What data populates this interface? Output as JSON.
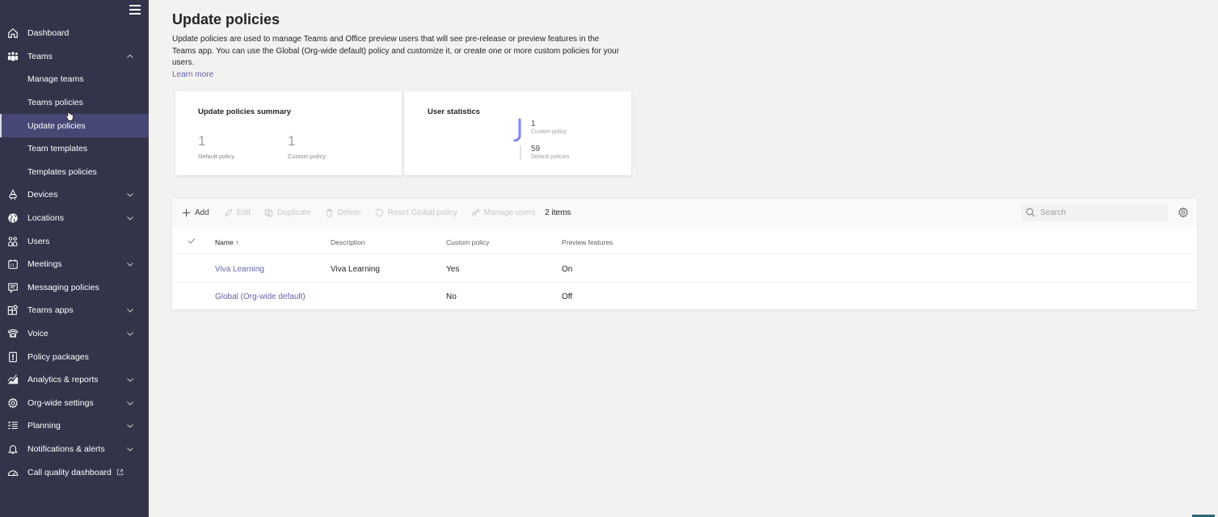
{
  "sidebar": {
    "menu_icon": "hamburger-icon",
    "items": [
      {
        "label": "Dashboard",
        "icon": "home-icon",
        "level": 0,
        "chevron": null
      },
      {
        "label": "Teams",
        "icon": "teams-icon",
        "level": 0,
        "chevron": "up"
      },
      {
        "label": "Manage teams",
        "icon": null,
        "level": 1,
        "chevron": null
      },
      {
        "label": "Teams policies",
        "icon": null,
        "level": 1,
        "chevron": null
      },
      {
        "label": "Update policies",
        "icon": null,
        "level": 1,
        "chevron": null,
        "active": true
      },
      {
        "label": "Team templates",
        "icon": null,
        "level": 1,
        "chevron": null
      },
      {
        "label": "Templates policies",
        "icon": null,
        "level": 1,
        "chevron": null
      },
      {
        "label": "Devices",
        "icon": "devices-icon",
        "level": 0,
        "chevron": "down"
      },
      {
        "label": "Locations",
        "icon": "globe-icon",
        "level": 0,
        "chevron": "down"
      },
      {
        "label": "Users",
        "icon": "users-icon",
        "level": 0,
        "chevron": null
      },
      {
        "label": "Meetings",
        "icon": "calendar-icon",
        "level": 0,
        "chevron": "down"
      },
      {
        "label": "Messaging policies",
        "icon": "message-icon",
        "level": 0,
        "chevron": null
      },
      {
        "label": "Teams apps",
        "icon": "apps-icon",
        "level": 0,
        "chevron": "down"
      },
      {
        "label": "Voice",
        "icon": "phone-icon",
        "level": 0,
        "chevron": "down"
      },
      {
        "label": "Policy packages",
        "icon": "package-icon",
        "level": 0,
        "chevron": null
      },
      {
        "label": "Analytics & reports",
        "icon": "analytics-icon",
        "level": 0,
        "chevron": "down"
      },
      {
        "label": "Org-wide settings",
        "icon": "gear-icon",
        "level": 0,
        "chevron": "down"
      },
      {
        "label": "Planning",
        "icon": "checklist-icon",
        "level": 0,
        "chevron": "down"
      },
      {
        "label": "Notifications & alerts",
        "icon": "bell-icon",
        "level": 0,
        "chevron": "down"
      },
      {
        "label": "Call quality dashboard",
        "icon": "gauge-icon",
        "level": 0,
        "chevron": null,
        "external": true
      }
    ]
  },
  "header": {
    "title": "Update policies",
    "description": "Update policies are used to manage Teams and Office preview users that will see pre-release or preview features in the Teams app. You can use the Global (Org-wide default) policy and customize it, or create one or more custom policies for your users.",
    "learn_more": "Learn more"
  },
  "summary_card": {
    "title": "Update policies summary",
    "stats": [
      {
        "value": "1",
        "label": "Default policy"
      },
      {
        "value": "1",
        "label": "Custom policy"
      }
    ]
  },
  "user_stats_card": {
    "title": "User statistics",
    "segments": [
      {
        "value": "1",
        "label": "Custom policy",
        "color": "#7f85f5"
      },
      {
        "value": "59",
        "label": "Default policies",
        "color": "#e1dfdd"
      }
    ]
  },
  "toolbar": {
    "add": "Add",
    "edit": "Edit",
    "duplicate": "Duplicate",
    "delete": "Delete",
    "reset": "Reset Global policy",
    "manage_users": "Manage users",
    "items_count": "2 items",
    "search_placeholder": "Search"
  },
  "table": {
    "columns": [
      "Name",
      "Description",
      "Custom policy",
      "Preview features"
    ],
    "sort_indicator": "↑",
    "rows": [
      {
        "name": "Viva Learning",
        "description": "Viva Learning",
        "custom": "Yes",
        "preview": "On"
      },
      {
        "name": "Global (Org-wide default)",
        "description": "",
        "custom": "No",
        "preview": "Off"
      }
    ]
  },
  "colors": {
    "sidebar_bg": "#33344a",
    "sidebar_active": "#464775",
    "accent": "#6264a7",
    "page_bg": "#f3f2f1"
  }
}
